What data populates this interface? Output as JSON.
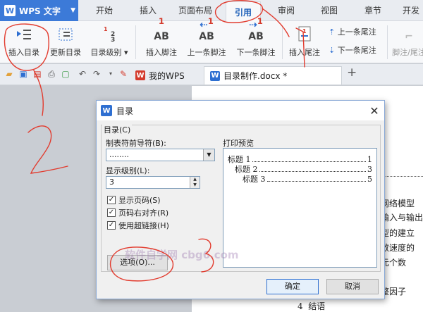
{
  "app": {
    "name": "WPS 文字",
    "logo": "W"
  },
  "tabs": [
    "开始",
    "插入",
    "页面布局",
    "引用",
    "审阅",
    "视图",
    "章节",
    "开发工"
  ],
  "active_tab": "引用",
  "ribbon": {
    "insert_toc": "插入目录",
    "update_toc": "更新目录",
    "toc_level": "目录级别",
    "insert_footnote": "插入脚注",
    "prev_footnote": "上一条脚注",
    "next_footnote": "下一条脚注",
    "insert_endnote": "插入尾注",
    "prev_endnote": "上一条尾注",
    "next_endnote": "下一条尾注",
    "footnote_endnote": "脚注/尾注",
    "ab_glyph": "AB",
    "one_glyph": "1"
  },
  "doc_tabs": [
    {
      "label": "我的WPS",
      "icon": "W"
    },
    {
      "label": "目录制作.docx *",
      "icon": "W"
    }
  ],
  "add_tab": "+",
  "document_lines": [
    "网络模型",
    "输入与输出",
    "型的建立",
    "敛速度的",
    "元个数",
    "整因子"
  ],
  "document_footer": {
    "num": "4",
    "text": "结语"
  },
  "dialog": {
    "title": "目录",
    "close": "✕",
    "group_label": "目录(C)",
    "leader_label": "制表符前导符(B):",
    "leader_value": "........",
    "level_label": "显示级别(L):",
    "level_value": "3",
    "show_page_numbers": "显示页码(S)",
    "right_align": "页码右对齐(R)",
    "use_hyperlinks": "使用超链接(H)",
    "check_mark": "✓",
    "preview_label": "打印预览",
    "preview": [
      {
        "text": "标题 1",
        "page": "1"
      },
      {
        "text": "标题 2",
        "page": "3"
      },
      {
        "text": "标题 3",
        "page": "5"
      }
    ],
    "options_button": "选项(O)...",
    "ok_button": "确定",
    "cancel_button": "取消"
  },
  "watermark": "软件自学网 cbg6.com",
  "colors": {
    "accent": "#3c7ad8",
    "annotation": "#e23b2e"
  }
}
